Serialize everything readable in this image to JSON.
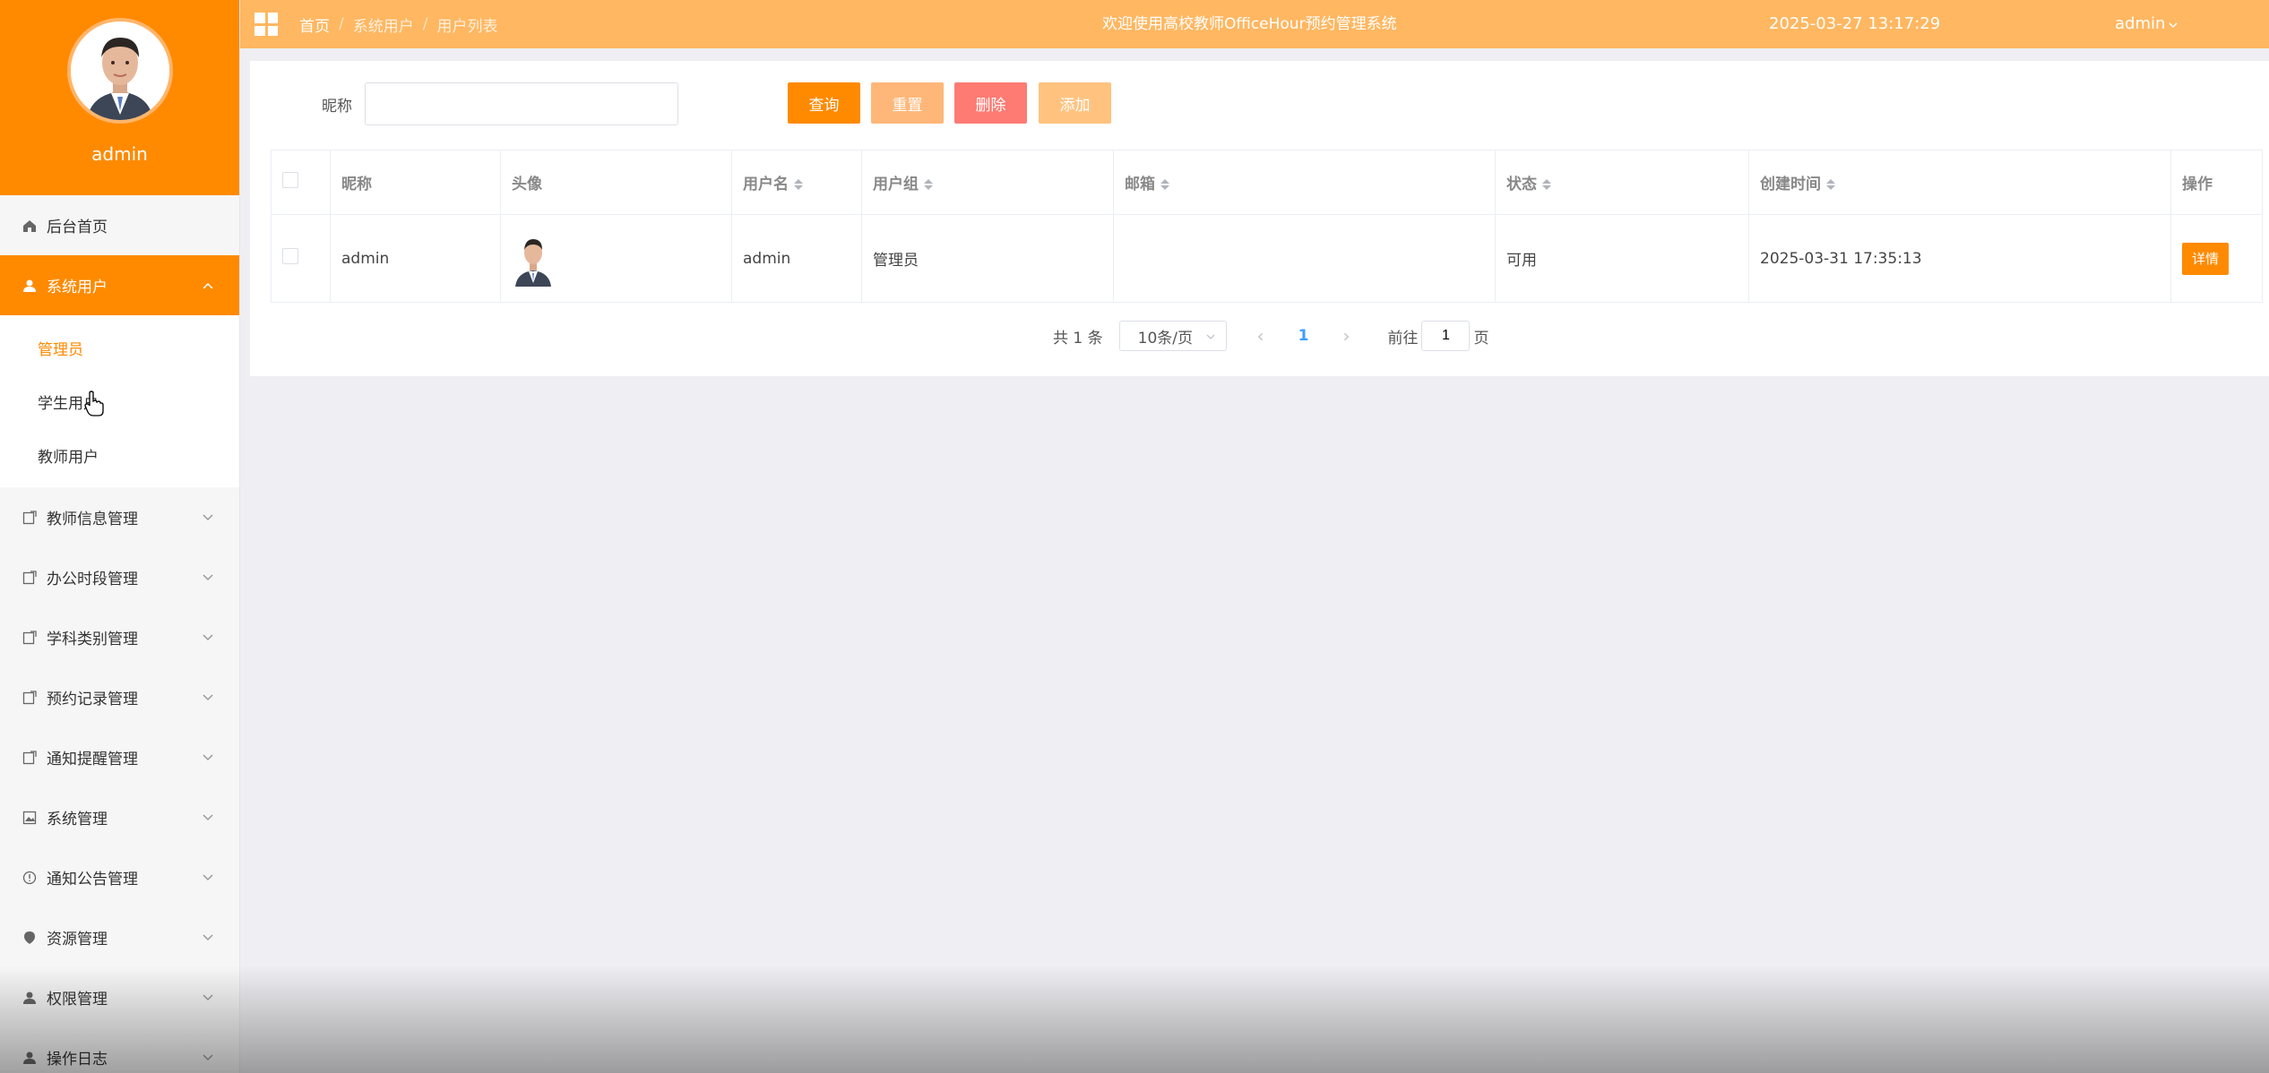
{
  "sidebar": {
    "username": "admin",
    "items": [
      {
        "label": "后台首页",
        "icon": "home-icon"
      },
      {
        "label": "系统用户",
        "icon": "user-icon"
      },
      {
        "label": "教师信息管理",
        "icon": "document-icon"
      },
      {
        "label": "办公时段管理",
        "icon": "document-icon"
      },
      {
        "label": "学科类别管理",
        "icon": "document-icon"
      },
      {
        "label": "预约记录管理",
        "icon": "document-icon"
      },
      {
        "label": "通知提醒管理",
        "icon": "document-icon"
      },
      {
        "label": "系统管理",
        "icon": "picture-icon"
      },
      {
        "label": "通知公告管理",
        "icon": "info-icon"
      },
      {
        "label": "资源管理",
        "icon": "pin-icon"
      },
      {
        "label": "权限管理",
        "icon": "user-icon"
      },
      {
        "label": "操作日志",
        "icon": "user-icon"
      }
    ],
    "subitems": [
      {
        "label": "管理员"
      },
      {
        "label": "学生用户"
      },
      {
        "label": "教师用户"
      }
    ]
  },
  "header": {
    "breadcrumb": [
      "首页",
      "系统用户",
      "用户列表"
    ],
    "breadcrumb_sep": "/",
    "title": "欢迎使用高校教师OfficeHour预约管理系统",
    "time": "2025-03-27 13:17:29",
    "user": "admin"
  },
  "search": {
    "label": "昵称",
    "value": "",
    "placeholder": ""
  },
  "toolbar": {
    "query": "查询",
    "reset": "重置",
    "delete": "删除",
    "add": "添加"
  },
  "table": {
    "columns": [
      "昵称",
      "头像",
      "用户名",
      "用户组",
      "邮箱",
      "状态",
      "创建时间",
      "操作"
    ],
    "rows": [
      {
        "nickname": "admin",
        "username": "admin",
        "group": "管理员",
        "email": "",
        "status": "可用",
        "created": "2025-03-31 17:35:13",
        "action": "详情"
      }
    ]
  },
  "pagination": {
    "total": "共 1 条",
    "page_size": "10条/页",
    "current": "1",
    "goto_label": "前往",
    "goto_value": "1",
    "goto_unit": "页"
  },
  "colors": {
    "accent": "#ff8a00",
    "header": "#ffb761",
    "reset": "#ffb779",
    "delete": "#fd7b73",
    "add": "#ffc37f"
  }
}
